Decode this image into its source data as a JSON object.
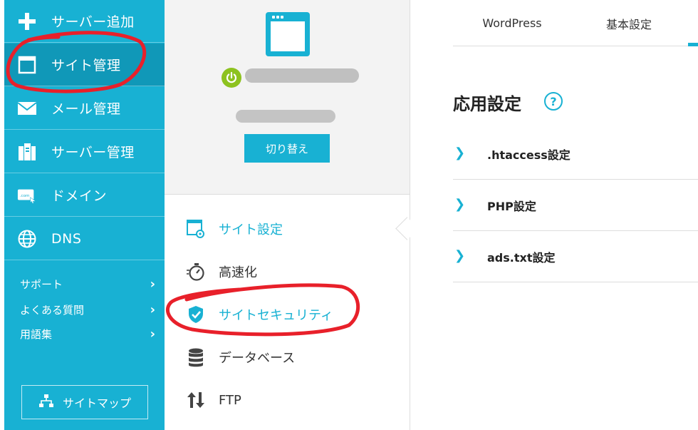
{
  "sidebar": {
    "items": [
      {
        "label": "サーバー追加",
        "icon": "plus-icon"
      },
      {
        "label": "サイト管理",
        "icon": "window-icon"
      },
      {
        "label": "メール管理",
        "icon": "mail-icon"
      },
      {
        "label": "サーバー管理",
        "icon": "server-icon"
      },
      {
        "label": "ドメイン",
        "icon": "domain-icon"
      },
      {
        "label": "DNS",
        "icon": "globe-icon"
      }
    ],
    "links": [
      "サポート",
      "よくある質問",
      "用語集"
    ],
    "sitemap_label": "サイトマップ"
  },
  "site_panel": {
    "switch_label": "切り替え"
  },
  "site_menu": [
    {
      "label": "サイト設定",
      "icon": "site-settings-icon"
    },
    {
      "label": "高速化",
      "icon": "stopwatch-icon"
    },
    {
      "label": "サイトセキュリティ",
      "icon": "shield-check-icon"
    },
    {
      "label": "データベース",
      "icon": "database-icon"
    },
    {
      "label": "FTP",
      "icon": "updown-arrows-icon"
    }
  ],
  "tabs": [
    "WordPress",
    "基本設定"
  ],
  "main": {
    "section_title": "応用設定",
    "help": "?",
    "rows": [
      ".htaccess設定",
      "PHP設定",
      "ads.txt設定"
    ],
    "chevron": "❯"
  },
  "colors": {
    "accent": "#18b1d3",
    "accent_dark": "#1098b8",
    "power": "#8dc21f",
    "annotation": "#e8202a"
  }
}
